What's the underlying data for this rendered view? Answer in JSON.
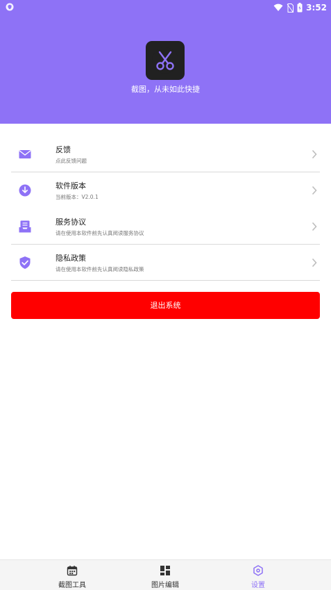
{
  "status_bar": {
    "time": "3:52"
  },
  "header": {
    "slogan": "截图，从未如此快捷"
  },
  "colors": {
    "accent": "#8e72f6",
    "danger": "#ff0000",
    "logo_bg": "#212121"
  },
  "menu": [
    {
      "title": "反馈",
      "subtitle": "点此反馈问题",
      "icon": "mail-icon"
    },
    {
      "title": "软件版本",
      "subtitle": "当前版本：V2.0.1",
      "icon": "download-icon"
    },
    {
      "title": "服务协议",
      "subtitle": "请在使用本软件前先认真阅读服务协议",
      "icon": "inbox-icon"
    },
    {
      "title": "隐私政策",
      "subtitle": "请在使用本软件前先认真阅读隐私政策",
      "icon": "shield-check-icon"
    }
  ],
  "logout_label": "退出系统",
  "tabs": [
    {
      "label": "截图工具",
      "icon": "calendar-icon",
      "active": false
    },
    {
      "label": "图片编辑",
      "icon": "grid-icon",
      "active": false
    },
    {
      "label": "设置",
      "icon": "hexagon-settings-icon",
      "active": true
    }
  ]
}
